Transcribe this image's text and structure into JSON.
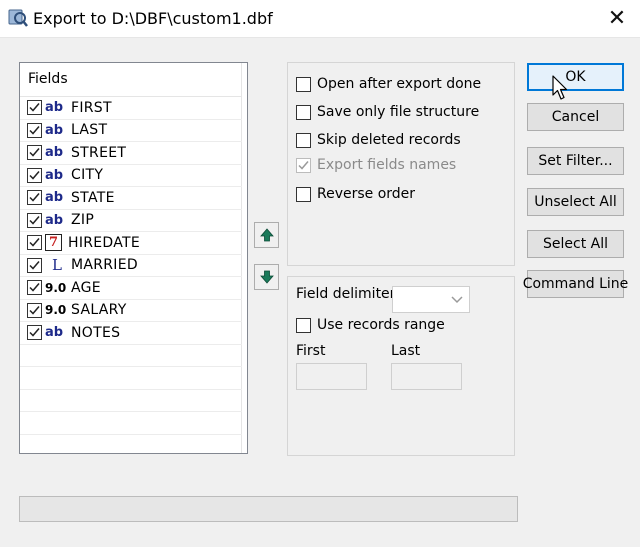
{
  "window": {
    "title": "Export to D:\\DBF\\custom1.dbf",
    "close_glyph": "✕"
  },
  "fields_panel": {
    "header": "Fields",
    "items": [
      {
        "type_icon": "ab",
        "name": "FIRST",
        "checked": true
      },
      {
        "type_icon": "ab",
        "name": "LAST",
        "checked": true
      },
      {
        "type_icon": "ab",
        "name": "STREET",
        "checked": true
      },
      {
        "type_icon": "ab",
        "name": "CITY",
        "checked": true
      },
      {
        "type_icon": "ab",
        "name": "STATE",
        "checked": true
      },
      {
        "type_icon": "ab",
        "name": "ZIP",
        "checked": true
      },
      {
        "type_icon": "7",
        "name": "HIREDATE",
        "checked": true
      },
      {
        "type_icon": "L",
        "name": "MARRIED",
        "checked": true
      },
      {
        "type_icon": "9.0",
        "name": "AGE",
        "checked": true
      },
      {
        "type_icon": "9.0",
        "name": "SALARY",
        "checked": true
      },
      {
        "type_icon": "ab",
        "name": "NOTES",
        "checked": true
      }
    ]
  },
  "move_buttons": {
    "up_icon": "arrow-up-icon",
    "down_icon": "arrow-down-icon",
    "color": "#1a7a5a"
  },
  "options": {
    "open_after_export": {
      "label": "Open after export done",
      "checked": false
    },
    "save_structure": {
      "label": "Save only file structure",
      "checked": false
    },
    "skip_deleted": {
      "label": "Skip deleted records",
      "checked": false
    },
    "export_field_names": {
      "label": "Export fields names",
      "checked": true,
      "disabled": true
    },
    "reverse_order": {
      "label": "Reverse order",
      "checked": false
    }
  },
  "delimiter": {
    "label": "Field delimiter",
    "value": "",
    "use_range": {
      "label": "Use records range",
      "checked": false
    },
    "first_label": "First",
    "last_label": "Last",
    "first_value": "",
    "last_value": ""
  },
  "buttons": {
    "ok": "OK",
    "cancel": "Cancel",
    "set_filter": "Set Filter...",
    "unselect_all": "Unselect All",
    "select_all": "Select All",
    "command_line": "Command Line"
  },
  "colors": {
    "accent": "#0078d7",
    "string_type": "#1e2a8a",
    "date_type": "#c62020"
  }
}
